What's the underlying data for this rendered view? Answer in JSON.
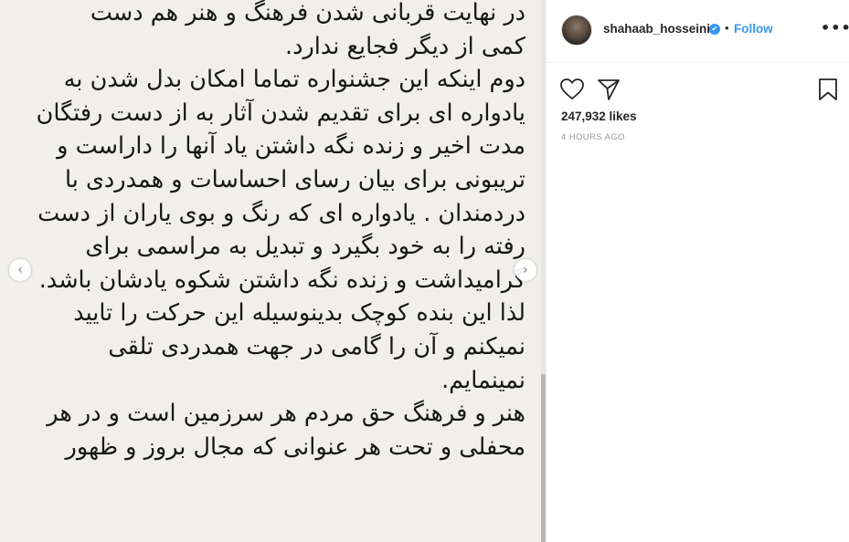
{
  "media": {
    "text_lines": [
      "در نهایت قربانی شدن فرهنگ و هنر هم دست",
      "کمی از دیگر فجایع ندارد.",
      "دوم اینکه این جشنواره تماما امکان بدل شدن به",
      "یادواره ای برای تقدیم شدن آثار به از دست رفتگان",
      "مدت اخیر و زنده نگه داشتن یاد آنها را داراست و",
      "تریبونی برای بیان رسای احساسات و همدردی با",
      "دردمندان . یادواره ای که رنگ و بوی یاران از دست",
      "رفته را به خود بگیرد و تبدیل به مراسمی برای",
      "گرامیداشت و زنده نگه داشتن شکوه یادشان باشد.",
      "لذا این بنده کوچک بدینوسیله این حرکت را تایید",
      "نمیکنم و آن را گامی در جهت همدردی تلقی",
      "نمینمایم.",
      "هنر و فرهنگ حق مردم هر سرزمین است و در هر",
      "محفلی و تحت هر عنوانی که مجال بروز و ظهور"
    ],
    "prev_icon": "chevron-left-icon",
    "next_icon": "chevron-right-icon",
    "prev_glyph": "‹",
    "next_glyph": "›"
  },
  "header": {
    "username": "shahaab_hosseini",
    "verified_icon": "verified-badge-icon",
    "verified_glyph": "✔",
    "separator": "•",
    "follow_label": "Follow",
    "more_icon": "more-options-icon",
    "more_glyph": "•••"
  },
  "actions": {
    "like_icon": "heart-icon",
    "share_icon": "share-icon",
    "save_icon": "bookmark-icon"
  },
  "stats": {
    "likes": "247,932 likes",
    "time": "4 HOURS AGO"
  },
  "colors": {
    "accent": "#3897f0",
    "text": "#262626",
    "muted": "#999999",
    "media_bg": "#f1efec"
  }
}
